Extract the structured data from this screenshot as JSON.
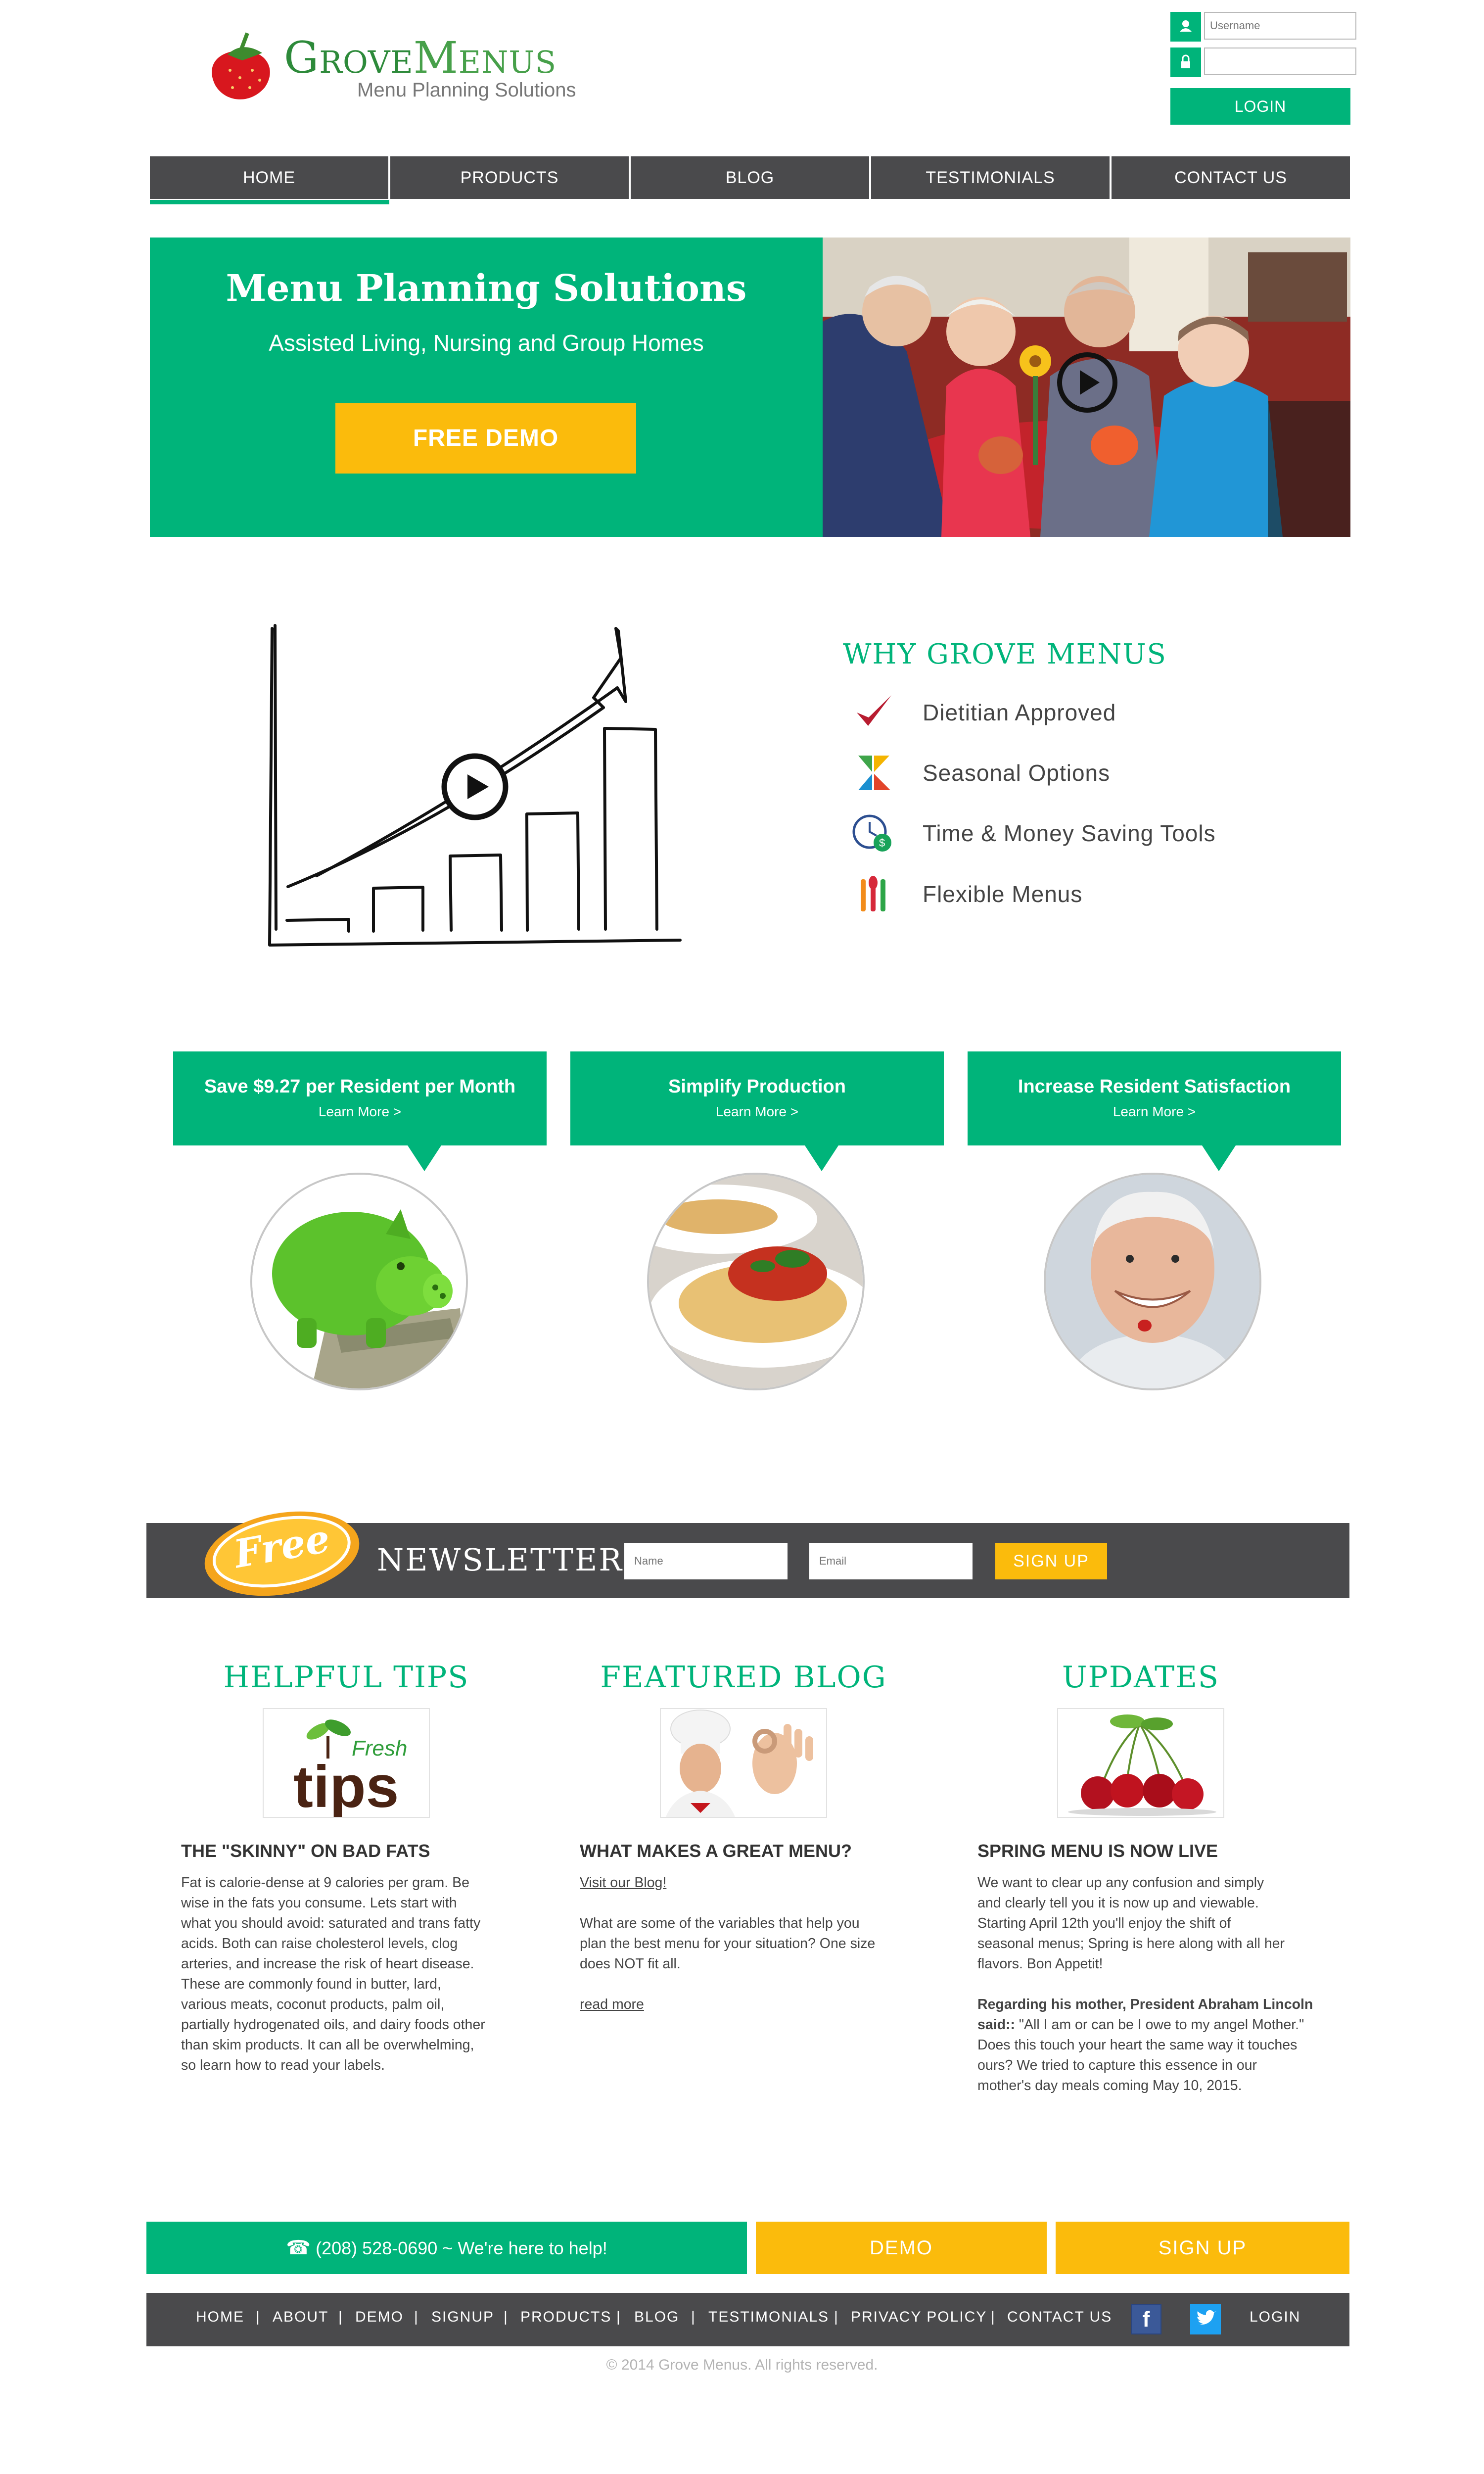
{
  "brand": {
    "logo_word_1": "Grove",
    "logo_word_2": "Menus",
    "tagline": "Menu Planning Solutions"
  },
  "login": {
    "username_placeholder": "Username",
    "password_placeholder": "",
    "button_label": "LOGIN",
    "user_icon": "user-icon",
    "lock_icon": "lock-icon"
  },
  "nav": {
    "items": [
      {
        "label": "HOME",
        "active": true
      },
      {
        "label": "PRODUCTS",
        "active": false
      },
      {
        "label": "BLOG",
        "active": false
      },
      {
        "label": "TESTIMONIALS",
        "active": false
      },
      {
        "label": "CONTACT US",
        "active": false
      }
    ]
  },
  "hero": {
    "title": "Menu Planning Solutions",
    "subtitle": "Assisted Living, Nursing and Group Homes",
    "cta_label": "FREE DEMO",
    "photo_icon": "play-icon"
  },
  "why": {
    "title": "WHY GROVE MENUS",
    "items": [
      {
        "label": "Dietitian Approved",
        "icon": "checkmark-icon"
      },
      {
        "label": "Seasonal Options",
        "icon": "seasons-icon"
      },
      {
        "label": "Time & Money Saving Tools",
        "icon": "clock-money-icon"
      },
      {
        "label": "Flexible Menus",
        "icon": "utensils-icon"
      }
    ]
  },
  "benefits": [
    {
      "title": "Save $9.27 per Resident per Month",
      "link": "Learn More >",
      "image": "piggy-bank"
    },
    {
      "title": "Simplify Production",
      "link": "Learn More >",
      "image": "spaghetti-plate"
    },
    {
      "title": "Increase Resident Satisfaction",
      "link": "Learn More >",
      "image": "smiling-senior"
    }
  ],
  "newsletter": {
    "badge": "Free",
    "title": "NEWSLETTER",
    "name_placeholder": "Name",
    "email_placeholder": "Email",
    "button_label": "SIGN UP"
  },
  "columns": [
    {
      "section_title": "HELPFUL TIPS",
      "image_text_1": "Fresh",
      "image_text_2": "tips",
      "heading": "THE \"SKINNY\" ON BAD FATS",
      "body_lines": [
        "Fat is calorie-dense at 9 calories per gram. Be",
        "wise in the fats you consume. Lets start with",
        "what you should avoid: saturated and trans fatty",
        "acids. Both can raise cholesterol levels, clog",
        "arteries, and increase the risk of heart disease.",
        "These are commonly found in butter, lard,",
        "various meats, coconut products, palm oil,",
        "partially hydrogenated oils, and dairy foods other",
        "than skim products. It can all be overwhelming,",
        "so learn how to read your labels."
      ]
    },
    {
      "section_title": "FEATURED BLOG",
      "heading": "WHAT MAKES A GREAT MENU?",
      "blog_link": "Visit our Blog!",
      "body_lines": [
        "What are some of the variables that help you",
        "plan the best menu for your situation? One size",
        "does NOT fit all."
      ],
      "read_more": "read more"
    },
    {
      "section_title": "UPDATES",
      "heading": "SPRING MENU IS NOW LIVE",
      "body_lines": [
        "We want to clear up any confusion and simply",
        "and clearly tell you it is now up and viewable.",
        "Starting April 12th you'll enjoy the shift of",
        "seasonal menus; Spring is here along with all her",
        "flavors. Bon Appetit!"
      ],
      "quote_lead": "Regarding his mother, President Abraham Lincoln said::",
      "quote_body": " \"All I am or can be I owe to my angel Mother.\" Does this touch your heart the same way it touches ours? We tried to capture this essence in our mother's day meals coming May 10, 2015."
    }
  ],
  "cta": {
    "phone": "(208) 528-0690 ~ We're here to help!",
    "demo": "DEMO",
    "signup": "SIGN UP"
  },
  "footer": {
    "links": [
      "HOME",
      "ABOUT",
      "DEMO",
      "SIGNUP",
      "PRODUCTS",
      "BLOG",
      "TESTIMONIALS",
      "PRIVACY POLICY",
      "CONTACT US"
    ],
    "facebook": "f",
    "login": "LOGIN",
    "copyright": "© 2014 Grove Menus. All rights reserved."
  },
  "colors": {
    "green": "#00b47a",
    "yellow": "#fbbb0c",
    "dark_gray": "#4a4a4c",
    "logo_green": "#2d8a3a"
  }
}
